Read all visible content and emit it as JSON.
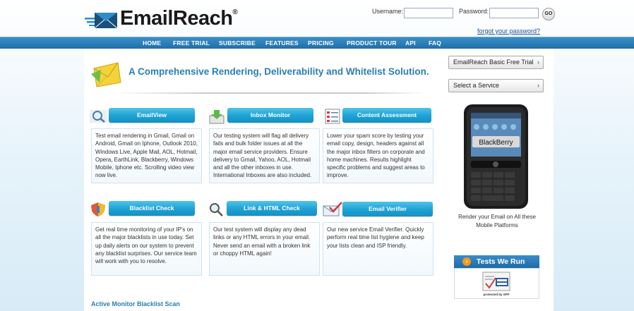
{
  "header": {
    "brand": "EmailReach",
    "reg_mark": "®",
    "username_label": "Username:",
    "password_label": "Password:",
    "go_label": "GO",
    "forgot_password": "forgot your password?"
  },
  "nav": {
    "items": [
      "HOME",
      "FREE TRIAL",
      "SUBSCRIBE",
      "FEATURES",
      "PRICING",
      "PRODUCT TOUR",
      "API",
      "FAQ"
    ]
  },
  "hero": {
    "title": "A Comprehensive Rendering, Deliverability and Whitelist Solution."
  },
  "services": [
    {
      "title": "EmailView",
      "icon": "magnifier-icon",
      "description": "Test email rendering in Gmail, Gmail on Android, Gmail on Iphone, Outlook 2010, Windows Live, Apple Mail, AOL, Hotmail, Opera, EarthLink, Blackberry, Windows Mobile, Iphone etc. Scrolling video view now live."
    },
    {
      "title": "Inbox Monitor",
      "icon": "inbox-download-icon",
      "description": "Our testing system will flag all delivery fails and bulk folder issues at all the major email service providers. Ensure delivery to Gmail, Yahoo, AOL, Hotmail and all the other inboxes in use. International Inboxes are also included."
    },
    {
      "title": "Content Assessment",
      "icon": "checklist-icon",
      "description": "Lower your spam score by testing your email copy, design, headers against all the major inbox filters on corporate and home machines. Results highlight specific problems and suggest areas to improve."
    },
    {
      "title": "Blacklist Check",
      "icon": "shield-icon",
      "description": "Get real time monitoring of your IP's on all the major blacklists in use today. Set up daily alerts on our system to prevent any blacklist surprises. Our service team will work with you to resolve."
    },
    {
      "title": "Link & HTML Check",
      "icon": "magnifier-icon",
      "description": "Our test system will display any dead links or any HTML errors in your email. Never send an email with a broken link or choppy HTML again!"
    },
    {
      "title": "Email Verifier",
      "icon": "email-check-icon",
      "description": "Our new service Email Verifier. Quickly perform real time list hygiene and keep your lists clean and ISP friendly."
    }
  ],
  "sidebar": {
    "free_trial_button": "EmailReach Basic Free Trial",
    "select_service": "Select a Service",
    "arrow": "›",
    "phone_screen_label": "BlackBerry",
    "phone_caption": "Render your Email on All these Mobile Platforms",
    "tests_title": "Tests We Run",
    "tests_icon_glyph": "›",
    "spf_badge_text": "protected by SPF"
  },
  "footer_section": {
    "title": "Active Monitor Blacklist Scan"
  },
  "colors": {
    "nav_bar": "#1f6fa8",
    "accent_blue": "#2a7fb5",
    "service_header": "#1da1d3",
    "logo_envelope": "#2a8fc8"
  }
}
